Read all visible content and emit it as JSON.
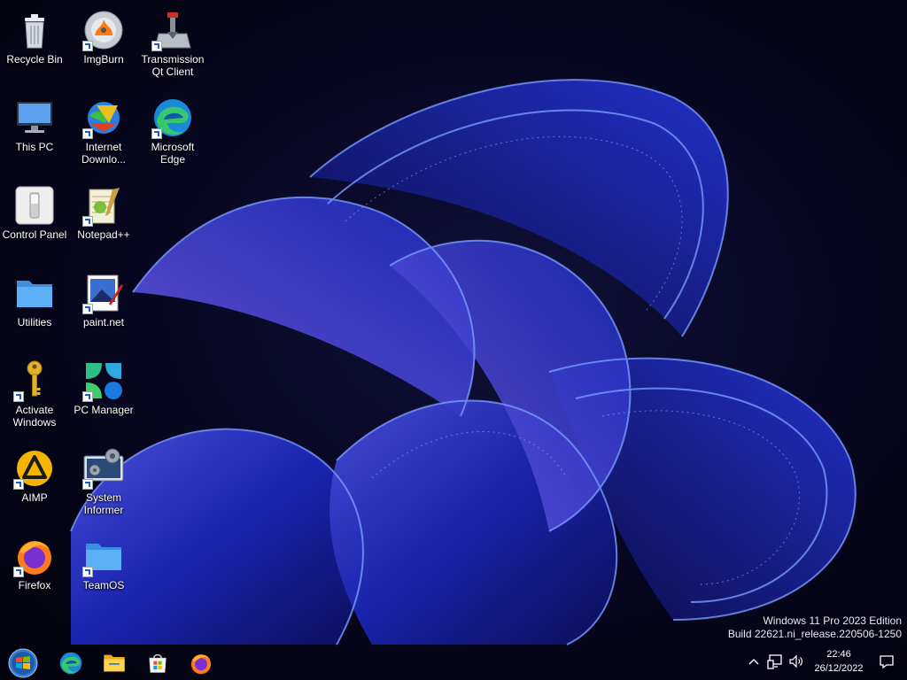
{
  "desktop": {
    "icons": [
      {
        "label": "Recycle Bin",
        "icon": "recycle-bin-icon",
        "shortcut": false
      },
      {
        "label": "This PC",
        "icon": "computer-icon",
        "shortcut": false
      },
      {
        "label": "Control Panel",
        "icon": "control-panel-icon",
        "shortcut": false
      },
      {
        "label": "Utilities",
        "icon": "folder-icon",
        "shortcut": false
      },
      {
        "label": "Activate\nWindows",
        "icon": "key-icon",
        "shortcut": true
      },
      {
        "label": "AIMP",
        "icon": "aimp-icon",
        "shortcut": true
      },
      {
        "label": "Firefox",
        "icon": "firefox-icon",
        "shortcut": true
      },
      {
        "label": "ImgBurn",
        "icon": "imgburn-icon",
        "shortcut": true
      },
      {
        "label": "Internet\nDownlo...",
        "icon": "internet-download-manager-icon",
        "shortcut": true
      },
      {
        "label": "Notepad++",
        "icon": "notepad-plus-plus-icon",
        "shortcut": true
      },
      {
        "label": "paint.net",
        "icon": "paint-net-icon",
        "shortcut": true
      },
      {
        "label": "PC Manager",
        "icon": "pc-manager-icon",
        "shortcut": true
      },
      {
        "label": "System\nInformer",
        "icon": "system-informer-icon",
        "shortcut": true
      },
      {
        "label": "TeamOS",
        "icon": "folder-icon",
        "shortcut": true
      },
      {
        "label": "Transmission\nQt Client",
        "icon": "transmission-icon",
        "shortcut": true
      },
      {
        "label": "Microsoft\nEdge",
        "icon": "edge-icon",
        "shortcut": true
      }
    ]
  },
  "watermark": {
    "line1": "Windows 11 Pro 2023 Edition",
    "line2": "Build 22621.ni_release.220506-1250"
  },
  "taskbar": {
    "pinned": [
      "start-orb-icon",
      "edge-icon",
      "file-explorer-icon",
      "microsoft-store-icon",
      "firefox-icon"
    ]
  },
  "tray": {
    "icons": [
      "chevron-up-icon",
      "network-icon",
      "volume-icon",
      "notification-icon"
    ],
    "time": "22:46",
    "date": "26/12/2022"
  },
  "colors": {
    "background": "#05041a",
    "accent_blue": "#2340d8",
    "ribbon_light": "#6a8cff"
  }
}
